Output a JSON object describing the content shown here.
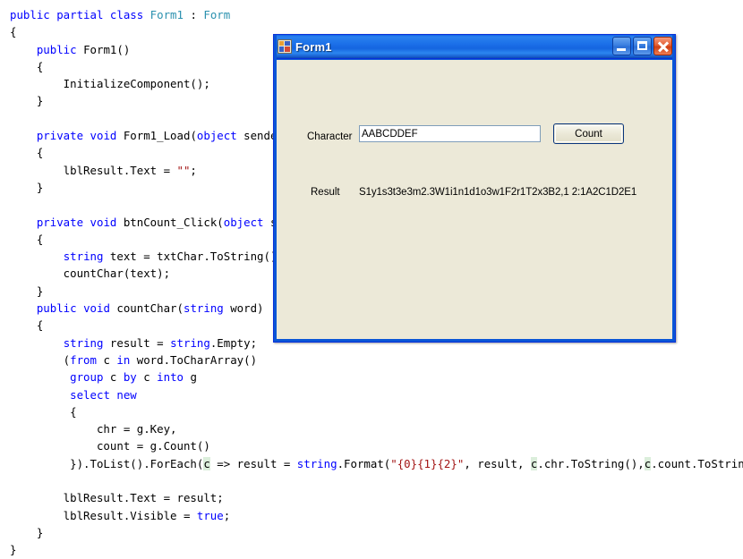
{
  "editor": {
    "language": "csharp",
    "lines": [
      [
        {
          "t": "public ",
          "c": "kw"
        },
        {
          "t": "partial ",
          "c": "kw"
        },
        {
          "t": "class ",
          "c": "kw"
        },
        {
          "t": "Form1",
          "c": "typ"
        },
        {
          "t": " : "
        },
        {
          "t": "Form",
          "c": "typ"
        }
      ],
      [
        {
          "t": "{"
        }
      ],
      [
        {
          "t": "    "
        },
        {
          "t": "public ",
          "c": "kw"
        },
        {
          "t": "Form1()"
        }
      ],
      [
        {
          "t": "    {"
        }
      ],
      [
        {
          "t": "        InitializeComponent();"
        }
      ],
      [
        {
          "t": "    }"
        }
      ],
      [],
      [
        {
          "t": "    "
        },
        {
          "t": "private ",
          "c": "kw"
        },
        {
          "t": "void ",
          "c": "kw"
        },
        {
          "t": "Form1_Load("
        },
        {
          "t": "object",
          "c": "kw"
        },
        {
          "t": " sender,"
        }
      ],
      [
        {
          "t": "    {"
        }
      ],
      [
        {
          "t": "        lblResult.Text = "
        },
        {
          "t": "\"\"",
          "c": "str"
        },
        {
          "t": ";"
        }
      ],
      [
        {
          "t": "    }"
        }
      ],
      [],
      [
        {
          "t": "    "
        },
        {
          "t": "private ",
          "c": "kw"
        },
        {
          "t": "void ",
          "c": "kw"
        },
        {
          "t": "btnCount_Click("
        },
        {
          "t": "object",
          "c": "kw"
        },
        {
          "t": " sen"
        }
      ],
      [
        {
          "t": "    {"
        }
      ],
      [
        {
          "t": "        "
        },
        {
          "t": "string",
          "c": "kw"
        },
        {
          "t": " text = txtChar.ToString();"
        }
      ],
      [
        {
          "t": "        countChar(text);"
        }
      ],
      [
        {
          "t": "    }"
        }
      ],
      [
        {
          "t": "    "
        },
        {
          "t": "public ",
          "c": "kw"
        },
        {
          "t": "void ",
          "c": "kw"
        },
        {
          "t": "countChar("
        },
        {
          "t": "string",
          "c": "kw"
        },
        {
          "t": " word)"
        }
      ],
      [
        {
          "t": "    {"
        }
      ],
      [
        {
          "t": "        "
        },
        {
          "t": "string",
          "c": "kw"
        },
        {
          "t": " result = "
        },
        {
          "t": "string",
          "c": "kw"
        },
        {
          "t": ".Empty;"
        }
      ],
      [
        {
          "t": "        ("
        },
        {
          "t": "from",
          "c": "kw"
        },
        {
          "t": " c "
        },
        {
          "t": "in",
          "c": "kw"
        },
        {
          "t": " word.ToCharArray()"
        }
      ],
      [
        {
          "t": "         "
        },
        {
          "t": "group",
          "c": "kw"
        },
        {
          "t": " c "
        },
        {
          "t": "by",
          "c": "kw"
        },
        {
          "t": " c "
        },
        {
          "t": "into",
          "c": "kw"
        },
        {
          "t": " g"
        }
      ],
      [
        {
          "t": "         "
        },
        {
          "t": "select",
          "c": "kw"
        },
        {
          "t": " "
        },
        {
          "t": "new",
          "c": "kw"
        }
      ],
      [
        {
          "t": "         {"
        }
      ],
      [
        {
          "t": "             chr = g.Key,"
        }
      ],
      [
        {
          "t": "             count = g.Count()"
        }
      ],
      [
        {
          "t": "         }).ToList().ForEach("
        },
        {
          "t": "c",
          "c": "hl"
        },
        {
          "t": " => result = "
        },
        {
          "t": "string",
          "c": "kw"
        },
        {
          "t": ".Format("
        },
        {
          "t": "\"{0}{1}{2}\"",
          "c": "str"
        },
        {
          "t": ", result, "
        },
        {
          "t": "c",
          "c": "hl"
        },
        {
          "t": ".chr.ToString(),"
        },
        {
          "t": "c",
          "c": "hl"
        },
        {
          "t": ".count.ToString());"
        }
      ],
      [],
      [
        {
          "t": "        lblResult.Text = result;"
        }
      ],
      [
        {
          "t": "        lblResult.Visible = "
        },
        {
          "t": "true",
          "c": "kw"
        },
        {
          "t": ";"
        }
      ],
      [
        {
          "t": "    }"
        }
      ],
      [
        {
          "t": "}"
        }
      ]
    ]
  },
  "form": {
    "title": "Form1",
    "icon": "windows-form-icon",
    "titlebar_buttons": {
      "minimize": "minimize-button",
      "maximize": "maximize-button",
      "close": "close-button"
    },
    "character_label": "Character",
    "character_value": "AABCDDEF",
    "character_placeholder": "",
    "count_button_label": "Count",
    "result_label": "Result",
    "result_value": "S1y1s3t3e3m2.3W1i1n1d1o3w1F2r1T2x3B2,1 2:1A2C1D2E1"
  },
  "colors": {
    "keyword": "#0000FF",
    "type": "#2B91AF",
    "string": "#A31515",
    "titlebar_blue": "#1565E0",
    "form_face": "#ECE9D8",
    "reference_highlight": "#DBEEDB"
  }
}
